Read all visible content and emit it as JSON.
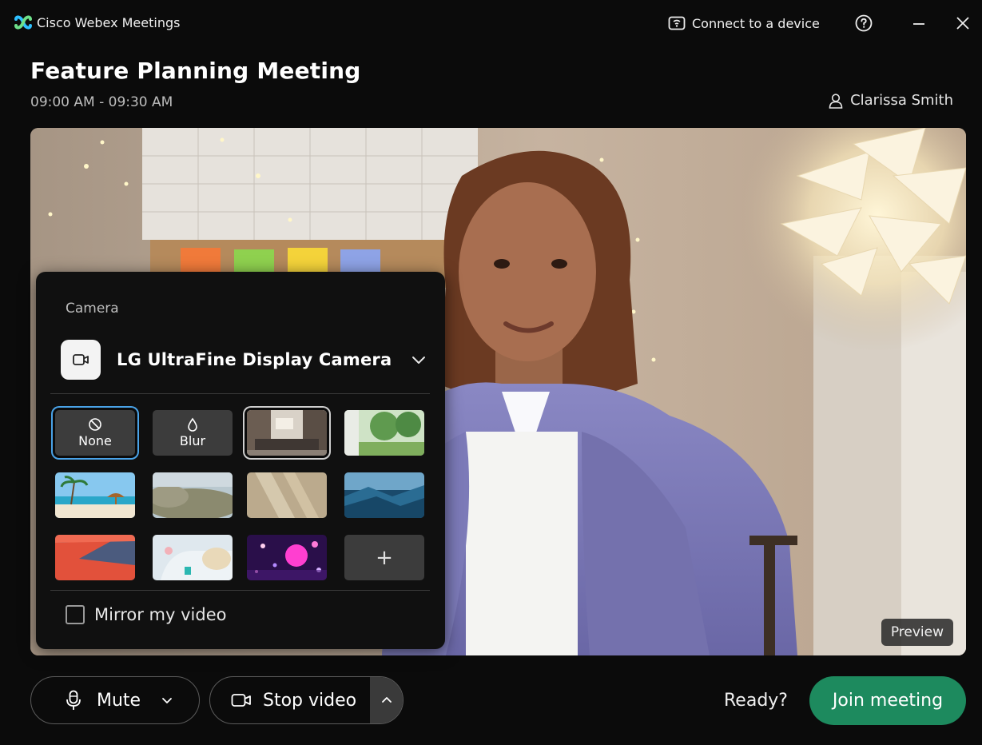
{
  "app": {
    "title": "Cisco Webex Meetings",
    "logo_icon": "webex-logo-icon"
  },
  "titlebar": {
    "connect_label": "Connect to a device",
    "help_icon": "help-icon",
    "minimize_icon": "minimize-icon",
    "close_icon": "close-icon"
  },
  "meeting": {
    "title": "Feature Planning Meeting",
    "time": "09:00 AM - 09:30 AM",
    "host": "Clarissa Smith"
  },
  "preview": {
    "badge": "Preview"
  },
  "camera_panel": {
    "heading": "Camera",
    "selected_camera": "LG UltraFine Display Camera",
    "backgrounds": [
      {
        "label": "None",
        "icon": "no-background-icon",
        "selected": true
      },
      {
        "label": "Blur",
        "icon": "blur-drop-icon"
      },
      {
        "name": "living-room",
        "selected": true
      },
      {
        "name": "forest"
      },
      {
        "name": "beach"
      },
      {
        "name": "blurry-landscape"
      },
      {
        "name": "sunlit-wall"
      },
      {
        "name": "blue-mountains"
      },
      {
        "name": "red-abstract"
      },
      {
        "name": "white-room"
      },
      {
        "name": "purple-bokeh"
      },
      {
        "label": "+"
      }
    ],
    "mirror_label": "Mirror my video",
    "mirror_checked": false
  },
  "controls": {
    "mute_label": "Mute",
    "stop_video_label": "Stop video",
    "ready_label": "Ready?",
    "join_label": "Join meeting"
  },
  "colors": {
    "background": "#0b0b0b",
    "join_button": "#1d8a5e",
    "selection_blue": "#4aa3e8"
  }
}
